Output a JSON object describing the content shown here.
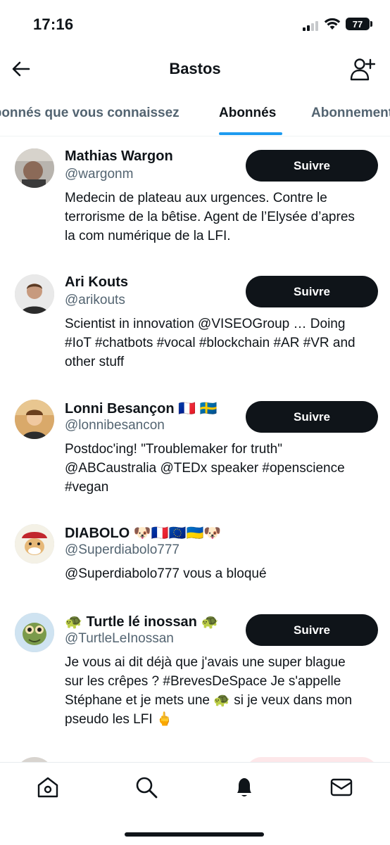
{
  "status_bar": {
    "time": "17:16",
    "battery": "77"
  },
  "header": {
    "title": "Bastos"
  },
  "tabs": [
    {
      "label": "Abonnés que vous connaissez"
    },
    {
      "label": "Abonnés"
    },
    {
      "label": "Abonnements"
    }
  ],
  "follow_label": "Suivre",
  "users": [
    {
      "name": "Mathias Wargon",
      "handle": "@wargonm",
      "bio": "Medecin de plateau aux urgences. Contre le terrorisme de la bêtise. Agent de l’Elysée d’apres la com numérique de la LFI."
    },
    {
      "name": "Ari Kouts",
      "handle": "@arikouts",
      "bio": "Scientist in innovation @VISEOGroup … Doing #IoT #chatbots #vocal #blockchain #AR #VR and other stuff"
    },
    {
      "name": "Lonni Besançon 🇫🇷 🇸🇪",
      "handle": "@lonnibesancon",
      "bio": "Postdoc'ing! \"Troublemaker for truth\" @ABCaustralia @TEDx speaker #openscience #vegan"
    },
    {
      "name": "DIABOLO 🐶🇫🇷🇪🇺🇺🇦🐶",
      "handle": "@Superdiabolo777",
      "bio": "@Superdiabolo777 vous a bloqué"
    },
    {
      "name": "🐢 Turtle lé inossan 🐢",
      "handle": "@TurtleLeInossan",
      "bio": "Je vous ai dit déjà que j'avais une super blague sur les crêpes ? #BrevesDeSpace Je s'appelle Stéphane et je mets une 🐢 si je veux dans mon pseudo les LFI 🖕"
    }
  ],
  "colors": {
    "accent": "#1d9bf0",
    "text": "#0f1419",
    "secondary": "#536471",
    "button": "#0f1419"
  },
  "bottom_nav": [
    "home-icon",
    "search-icon",
    "notifications-icon",
    "messages-icon"
  ]
}
